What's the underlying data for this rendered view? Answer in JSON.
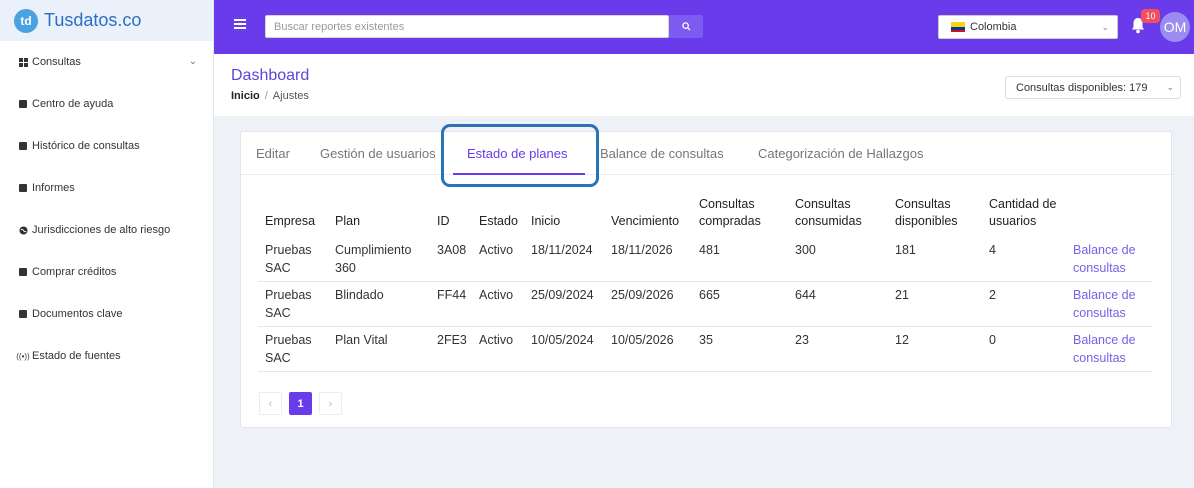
{
  "brand": {
    "logo_text": "td",
    "name": "Tusdatos.co"
  },
  "sidebar": {
    "items": [
      {
        "label": "Consultas",
        "icon": "grid-icon"
      },
      {
        "label": "Centro de ayuda",
        "icon": "help-book-icon"
      },
      {
        "label": "Histórico de consultas",
        "icon": "history-icon"
      },
      {
        "label": "Informes",
        "icon": "report-icon"
      },
      {
        "label": "Jurisdicciones de alto riesgo",
        "icon": "globe-icon"
      },
      {
        "label": "Comprar créditos",
        "icon": "wallet-icon"
      },
      {
        "label": "Documentos clave",
        "icon": "documents-icon"
      },
      {
        "label": "Estado de fuentes",
        "icon": "broadcast-icon"
      }
    ]
  },
  "topbar": {
    "search_placeholder": "Buscar reportes existentes",
    "country": "Colombia",
    "notifications_count": "10",
    "avatar_initials": "OM",
    "accent_color": "#6a3bea"
  },
  "header": {
    "title": "Dashboard",
    "breadcrumb_home": "Inicio",
    "breadcrumb_sep": "/",
    "breadcrumb_current": "Ajustes",
    "credits_label": "Consultas disponibles: 179"
  },
  "tabs": [
    {
      "label": "Editar"
    },
    {
      "label": "Gestión de usuarios"
    },
    {
      "label": "Estado de planes"
    },
    {
      "label": "Balance de consultas"
    },
    {
      "label": "Categorización de Hallazgos"
    }
  ],
  "table": {
    "columns": [
      "Empresa",
      "Plan",
      "ID",
      "Estado",
      "Inicio",
      "Vencimiento",
      "Consultas compradas",
      "Consultas consumidas",
      "Consultas disponibles",
      "Cantidad de usuarios",
      ""
    ],
    "rows": [
      {
        "empresa": "Pruebas SAC",
        "plan": "Cumplimiento 360",
        "id": "3A08",
        "estado": "Activo",
        "inicio": "18/11/2024",
        "vencimiento": "18/11/2026",
        "compradas": "481",
        "consumidas": "300",
        "disponibles": "181",
        "usuarios": "4",
        "action": "Balance de consultas"
      },
      {
        "empresa": "Pruebas SAC",
        "plan": "Blindado",
        "id": "FF44",
        "estado": "Activo",
        "inicio": "25/09/2024",
        "vencimiento": "25/09/2026",
        "compradas": "665",
        "consumidas": "644",
        "disponibles": "21",
        "usuarios": "2",
        "action": "Balance de consultas"
      },
      {
        "empresa": "Pruebas SAC",
        "plan": "Plan Vital",
        "id": "2FE3",
        "estado": "Activo",
        "inicio": "10/05/2024",
        "vencimiento": "10/05/2026",
        "compradas": "35",
        "consumidas": "23",
        "disponibles": "12",
        "usuarios": "0",
        "action": "Balance de consultas"
      }
    ]
  },
  "pagination": {
    "prev": "‹",
    "current": "1",
    "next": "›"
  }
}
